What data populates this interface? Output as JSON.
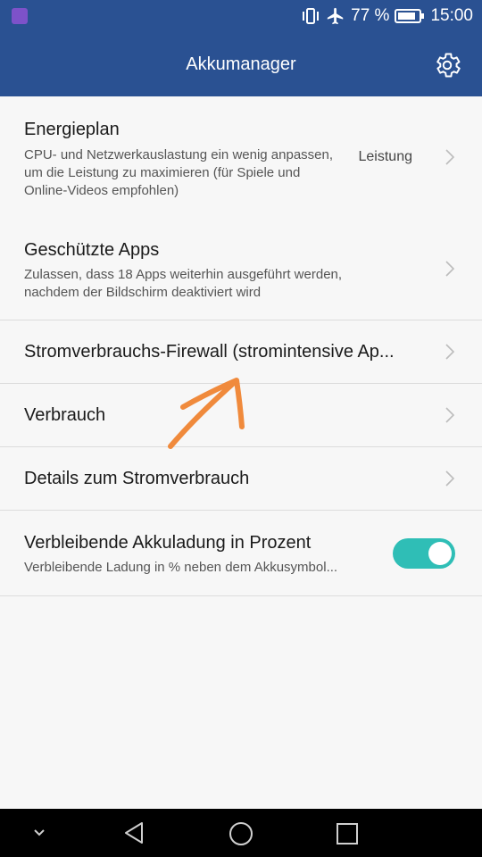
{
  "status_bar": {
    "battery_percent": "77 %",
    "time": "15:00"
  },
  "app_bar": {
    "title": "Akkumanager"
  },
  "items": [
    {
      "title": "Energieplan",
      "subtitle": "CPU- und Netzwerkauslastung ein wenig anpassen, um die Leistung zu maximieren (für Spiele und Online-Videos empfohlen)",
      "value": "Leistung"
    },
    {
      "title": "Geschützte Apps",
      "subtitle": "Zulassen, dass 18 Apps weiterhin ausgeführt werden, nachdem der Bildschirm deaktiviert wird"
    },
    {
      "title": "Stromverbrauchs-Firewall (stromintensive Ap..."
    },
    {
      "title": "Verbrauch"
    },
    {
      "title": "Details zum Stromverbrauch"
    },
    {
      "title": "Verbleibende Akkuladung in Prozent",
      "subtitle": "Verbleibende Ladung in % neben dem Akkusymbol...",
      "toggle_on": true
    }
  ],
  "colors": {
    "header": "#2a5192",
    "toggle_on": "#2fbeb6",
    "annotation": "#f08a3c"
  }
}
